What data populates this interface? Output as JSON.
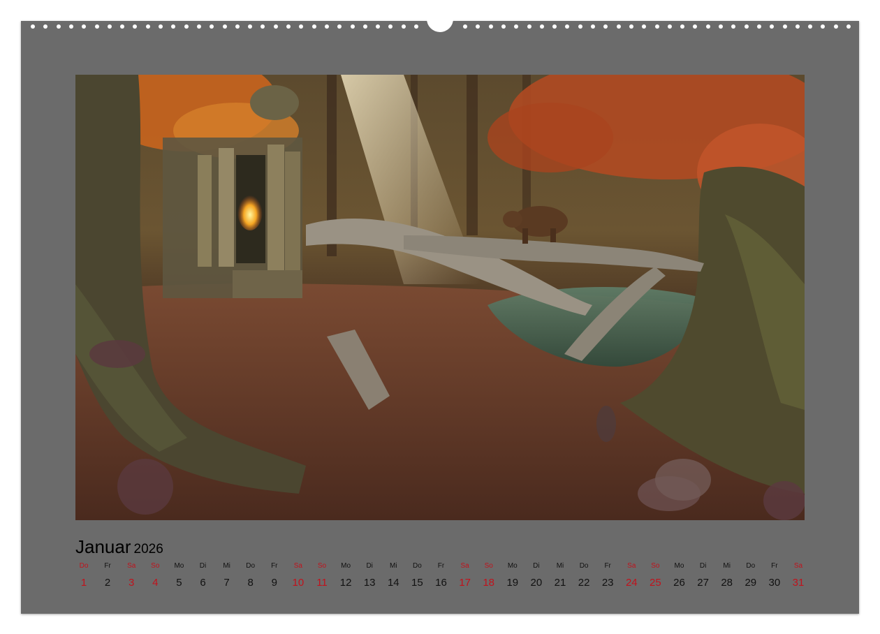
{
  "calendar": {
    "month": "Januar",
    "year": "2026",
    "weekend_color": "#c1121c",
    "days": [
      {
        "dow": "Do",
        "num": "1",
        "weekend": true
      },
      {
        "dow": "Fr",
        "num": "2",
        "weekend": false
      },
      {
        "dow": "Sa",
        "num": "3",
        "weekend": true
      },
      {
        "dow": "So",
        "num": "4",
        "weekend": true
      },
      {
        "dow": "Mo",
        "num": "5",
        "weekend": false
      },
      {
        "dow": "Di",
        "num": "6",
        "weekend": false
      },
      {
        "dow": "Mi",
        "num": "7",
        "weekend": false
      },
      {
        "dow": "Do",
        "num": "8",
        "weekend": false
      },
      {
        "dow": "Fr",
        "num": "9",
        "weekend": false
      },
      {
        "dow": "Sa",
        "num": "10",
        "weekend": true
      },
      {
        "dow": "So",
        "num": "11",
        "weekend": true
      },
      {
        "dow": "Mo",
        "num": "12",
        "weekend": false
      },
      {
        "dow": "Di",
        "num": "13",
        "weekend": false
      },
      {
        "dow": "Mi",
        "num": "14",
        "weekend": false
      },
      {
        "dow": "Do",
        "num": "15",
        "weekend": false
      },
      {
        "dow": "Fr",
        "num": "16",
        "weekend": false
      },
      {
        "dow": "Sa",
        "num": "17",
        "weekend": true
      },
      {
        "dow": "So",
        "num": "18",
        "weekend": true
      },
      {
        "dow": "Mo",
        "num": "19",
        "weekend": false
      },
      {
        "dow": "Di",
        "num": "20",
        "weekend": false
      },
      {
        "dow": "Mi",
        "num": "21",
        "weekend": false
      },
      {
        "dow": "Do",
        "num": "22",
        "weekend": false
      },
      {
        "dow": "Fr",
        "num": "23",
        "weekend": false
      },
      {
        "dow": "Sa",
        "num": "24",
        "weekend": true
      },
      {
        "dow": "So",
        "num": "25",
        "weekend": true
      },
      {
        "dow": "Mo",
        "num": "26",
        "weekend": false
      },
      {
        "dow": "Di",
        "num": "27",
        "weekend": false
      },
      {
        "dow": "Mi",
        "num": "28",
        "weekend": false
      },
      {
        "dow": "Do",
        "num": "29",
        "weekend": false
      },
      {
        "dow": "Fr",
        "num": "30",
        "weekend": false
      },
      {
        "dow": "Sa",
        "num": "31",
        "weekend": true
      }
    ]
  },
  "colors": {
    "sheet": "#6b6b6b",
    "page": "#ffffff"
  }
}
